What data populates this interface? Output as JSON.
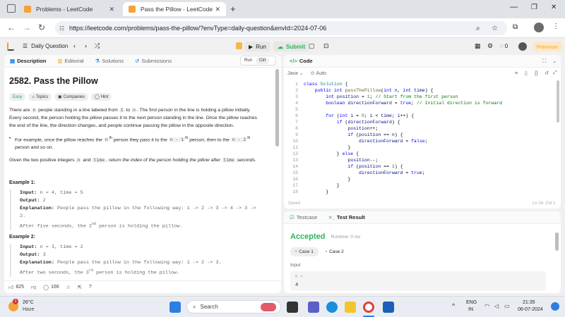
{
  "browser": {
    "tabs": [
      {
        "title": "Problems - LeetCode"
      },
      {
        "title": "Pass the Pillow - LeetCode"
      }
    ],
    "url": "https://leetcode.com/problems/pass-the-pillow/?envType=daily-question&envId=2024-07-06"
  },
  "nav": {
    "daily": "Daily Question",
    "run": "Run",
    "submit": "Submit",
    "streak": "0",
    "premium": "Premium",
    "tooltip_run": "Run",
    "tooltip_key": "Ctrl"
  },
  "left": {
    "tabs": [
      "Description",
      "Editorial",
      "Solutions",
      "Submissions"
    ],
    "title": "2582. Pass the Pillow",
    "tags": [
      "Easy",
      "Topics",
      "Companies",
      "Hint"
    ],
    "p1a": "There are",
    "p1n": "n",
    "p1b": "people standing in a line labeled from",
    "p1c": "1",
    "p1d": "to",
    "p1e": "n",
    "p1f": ". The first person in the line is holding a pillow initially.",
    "p1g": "Every second, the person holding the pillow passes it to the next person standing in the line. Once the pillow reaches",
    "p1h": "the end of the line, the direction changes, and people continue passing the pillow in the opposite direction.",
    "b1a": "For example, once the pillow reaches the",
    "b1b": "n",
    "b1sup": "th",
    "b1c": "person they pass it to the",
    "b1d": "n - 1",
    "b1sup2": "th",
    "b1e": "person, then to the",
    "b1f": "n - 2",
    "b1sup3": "th",
    "b1g": "person and so on.",
    "p2a": "Given the two positive integers",
    "p2b": "n",
    "p2c": "and",
    "p2d": "time",
    "p2e": ", return the index of the person holding the pillow after",
    "p2f": "time",
    "p2g": "seconds.",
    "ex1": {
      "title": "Example 1:",
      "input_lbl": "Input:",
      "input": "n = 4, time = 5",
      "output_lbl": "Output:",
      "output": "2",
      "expl_lbl": "Explanation:",
      "expl": "People pass the pillow in the following way: 1 -> 2 -> 3 -> 4 -> 3 ->",
      "expl2": "2.",
      "expl3a": "After five seconds, the 2",
      "expl3sup": "nd",
      "expl3b": "person is holding the pillow."
    },
    "ex2": {
      "title": "Example 2:",
      "input_lbl": "Input:",
      "input": "n = 3, time = 2",
      "output_lbl": "Output:",
      "output": "3",
      "expl_lbl": "Explanation:",
      "expl": "People pass the pillow in the following way: 1 -> 2 -> 3.",
      "expl3a": "After two seconds, the 3",
      "expl3sup": "rd",
      "expl3b": "person is holding the pillow."
    },
    "likes": "825",
    "comments": "166"
  },
  "code": {
    "tab": "Code",
    "lang": "Java",
    "mode": "Auto",
    "saved": "Saved",
    "cursor": "Ln 24, Col 1",
    "line_numbers": [
      "1",
      "2",
      "3",
      "4",
      "5",
      "6",
      "7",
      "8",
      "9",
      "10",
      "11",
      "12",
      "13",
      "14",
      "15",
      "16",
      "17",
      "18"
    ]
  },
  "testcase": {
    "tab1": "Testcase",
    "tab2": "Test Result",
    "status": "Accepted",
    "runtime": "Runtime: 0 ms",
    "case1": "Case 1",
    "case2": "Case 2",
    "input_lbl": "Input",
    "var": "n =",
    "val": "4"
  },
  "taskbar": {
    "temp": "26°C",
    "weather": "Haze",
    "search": "Search",
    "lang1": "ENG",
    "lang2": "IN",
    "time": "21:35",
    "date": "06-07-2024",
    "notif": "1"
  },
  "colors": {
    "easy": "#00af9b",
    "accepted": "#2db55d",
    "premium": "#ffa116",
    "link": "#007aff"
  }
}
